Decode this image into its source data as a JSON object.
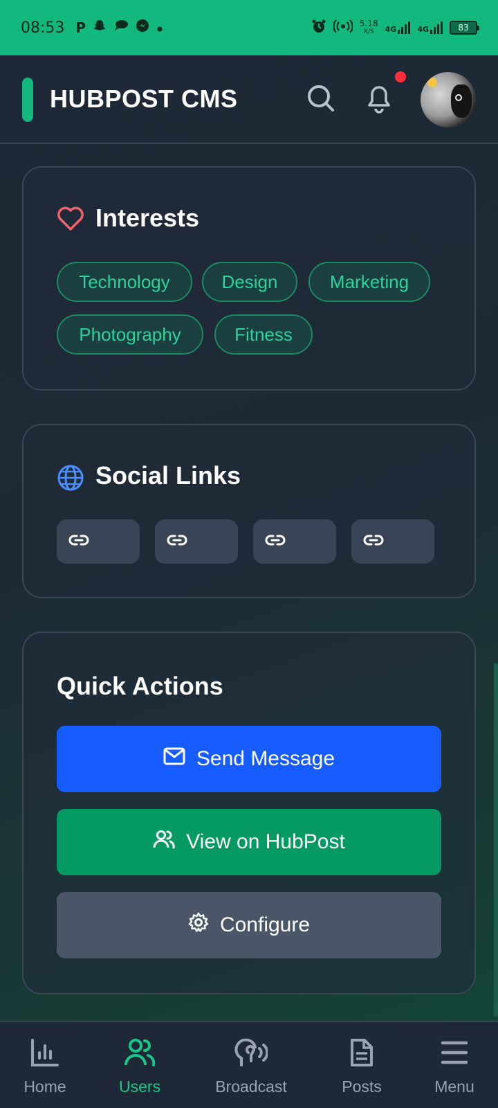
{
  "status_bar": {
    "time": "08:53",
    "notification_icons": [
      "P",
      "snapchat-icon",
      "chat-icon",
      "messenger-icon",
      "dot"
    ],
    "network_speed": "5.18",
    "network_unit": "K/S",
    "network_types": [
      "4G",
      "4G"
    ],
    "battery": "83"
  },
  "header": {
    "title": "HUBPOST CMS",
    "accent_color": "#12b87e"
  },
  "interests": {
    "title": "Interests",
    "tags": [
      "Technology",
      "Design",
      "Marketing",
      "Photography",
      "Fitness"
    ]
  },
  "social_links": {
    "title": "Social Links",
    "links": [
      "link-icon",
      "link-icon",
      "link-icon",
      "link-icon"
    ]
  },
  "quick_actions": {
    "title": "Quick Actions",
    "send_message": "Send Message",
    "view_on_hubpost": "View on HubPost",
    "configure": "Configure"
  },
  "bottom_nav": {
    "items": [
      "Home",
      "Users",
      "Broadcast",
      "Posts",
      "Menu"
    ],
    "active": "Users"
  },
  "colors": {
    "green": "#12b87e",
    "blue": "#175cff",
    "button_green": "#059a63",
    "button_gray": "#4a5567",
    "heart": "#f0646c",
    "globe": "#4c8dff"
  }
}
